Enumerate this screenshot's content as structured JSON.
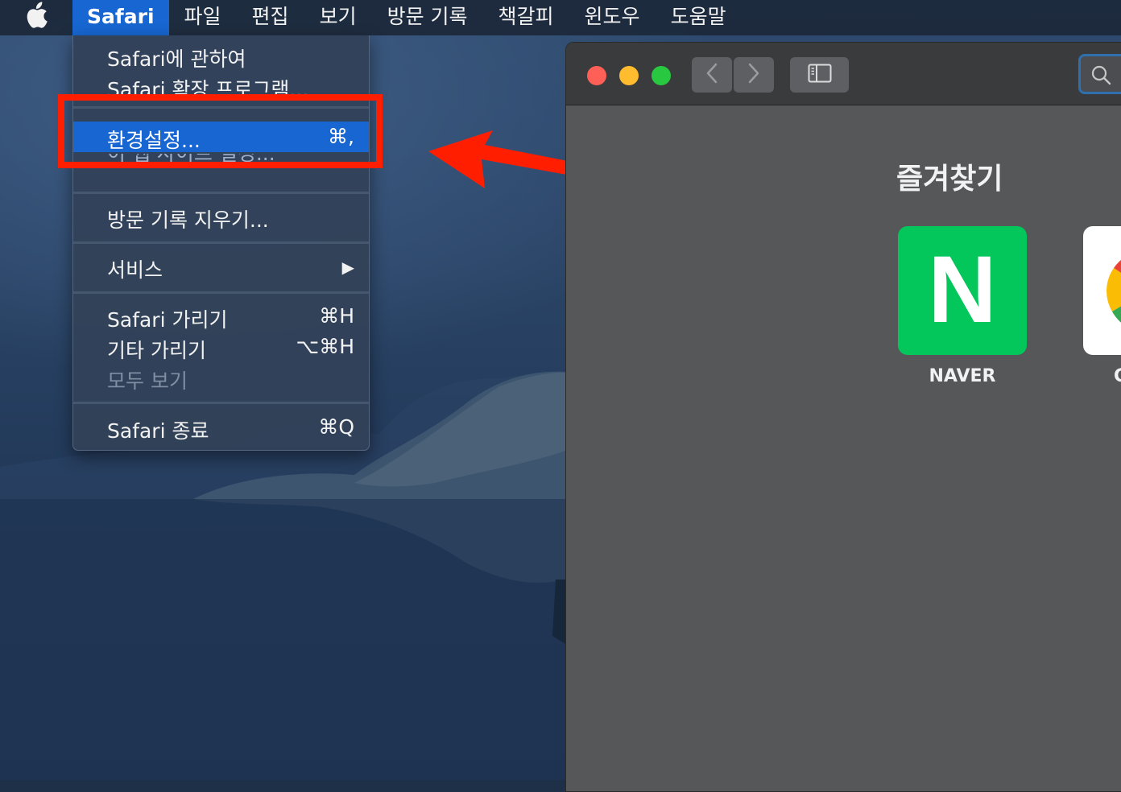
{
  "menubar": {
    "items": [
      "Safari",
      "파일",
      "편집",
      "보기",
      "방문 기록",
      "책갈피",
      "윈도우",
      "도움말"
    ],
    "active": "Safari"
  },
  "safari_menu": {
    "about": "Safari에 관하여",
    "extensions": "Safari 확장 프로그램...",
    "preferences": {
      "label": "환경설정...",
      "shortcut": "⌘,"
    },
    "website_settings_clipped": "이 웹 사이트 설정...",
    "clear_history": "방문 기록 지우기...",
    "services": {
      "label": "서비스",
      "submenu_indicator": "▶"
    },
    "hide_safari": {
      "label": "Safari 가리기",
      "shortcut": "⌘H"
    },
    "hide_others": {
      "label": "기타 가리기",
      "shortcut": "⌥⌘H"
    },
    "show_all": "모두 보기",
    "quit": {
      "label": "Safari 종료",
      "shortcut": "⌘Q"
    }
  },
  "safari_window": {
    "favorites_title": "즐겨찾기",
    "favorites": [
      {
        "label": "NAVER",
        "icon": "naver-n-logo",
        "color": "#03c75a",
        "letter": "N"
      },
      {
        "label": "G",
        "icon": "google-logo"
      }
    ]
  },
  "annotation": {
    "color": "#ff1f00"
  }
}
